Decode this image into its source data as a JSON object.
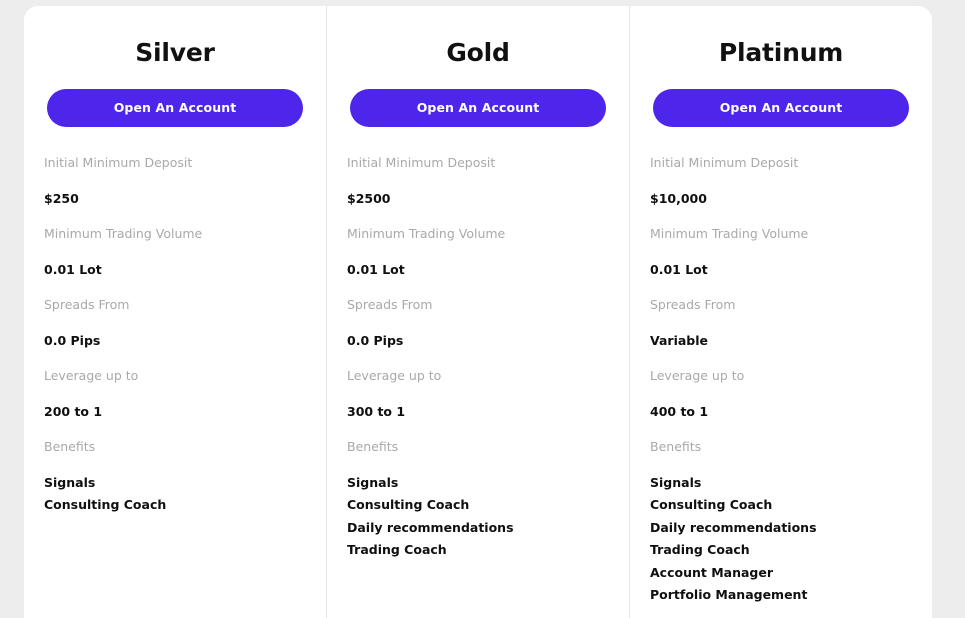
{
  "theme": {
    "page_background": "#ededed",
    "card_background": "#ffffff",
    "accent_button": "#4e25ea",
    "label_color": "#a9a9a9",
    "value_color": "#101010",
    "divider_color": "#e6e6e6"
  },
  "plans": [
    {
      "title": "Silver",
      "cta_label": "Open An Account",
      "specs": [
        {
          "label": "Initial Minimum Deposit",
          "value": "$250"
        },
        {
          "label": "Minimum Trading Volume",
          "value": "0.01 Lot"
        },
        {
          "label": "Spreads From",
          "value": "0.0 Pips"
        },
        {
          "label": "Leverage up to",
          "value": "200 to 1"
        }
      ],
      "benefits_label": "Benefits",
      "benefits": [
        "Signals",
        "Consulting Coach"
      ]
    },
    {
      "title": "Gold",
      "cta_label": "Open An Account",
      "specs": [
        {
          "label": "Initial Minimum Deposit",
          "value": "$2500"
        },
        {
          "label": "Minimum Trading Volume",
          "value": "0.01 Lot"
        },
        {
          "label": "Spreads From",
          "value": "0.0 Pips"
        },
        {
          "label": "Leverage up to",
          "value": "300 to 1"
        }
      ],
      "benefits_label": "Benefits",
      "benefits": [
        "Signals",
        "Consulting Coach",
        "Daily recommendations",
        "Trading Coach"
      ]
    },
    {
      "title": "Platinum",
      "cta_label": "Open An Account",
      "specs": [
        {
          "label": "Initial Minimum Deposit",
          "value": "$10,000"
        },
        {
          "label": "Minimum Trading Volume",
          "value": "0.01 Lot"
        },
        {
          "label": "Spreads From",
          "value": "Variable"
        },
        {
          "label": "Leverage up to",
          "value": "400 to 1"
        }
      ],
      "benefits_label": "Benefits",
      "benefits": [
        "Signals",
        "Consulting Coach",
        "Daily recommendations",
        "Trading Coach",
        "Account Manager",
        "Portfolio Management"
      ]
    }
  ]
}
